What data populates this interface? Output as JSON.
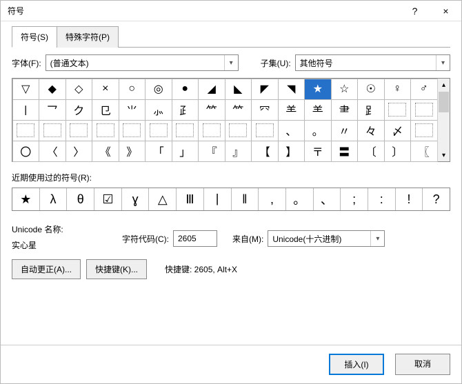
{
  "window": {
    "title": "符号",
    "help": "?",
    "close": "×"
  },
  "tabs": {
    "symbol": "符号(S)",
    "special": "特殊字符(P)"
  },
  "font": {
    "label": "字体(F):",
    "value": "(普通文本)"
  },
  "subset": {
    "label": "子集(U):",
    "value": "其他符号"
  },
  "grid": [
    [
      "▽",
      "◆",
      "◇",
      "×",
      "○",
      "◎",
      "●",
      "◢",
      "◣",
      "◤",
      "◥",
      "★",
      "☆",
      "☉",
      "♀",
      "♂"
    ],
    [
      "〡",
      "乛",
      "ク",
      "⺋",
      "⺌",
      "⺗",
      "⺪",
      "⺮",
      "⺮",
      "⺳",
      "⺷",
      "⺷",
      "⺻",
      "⻊",
      "⬚",
      "⬚"
    ],
    [
      "⬚",
      "⬚",
      "⬚",
      "⬚",
      "⬚",
      "⬚",
      "⬚",
      "⬚",
      "⬚",
      "⬚",
      "、",
      "。",
      "〃",
      "々",
      "〆",
      "⬚"
    ],
    [
      "〇",
      "〈",
      "〉",
      "《",
      "》",
      "「",
      "」",
      "『",
      "』",
      "【",
      "】",
      "〒",
      "〓",
      "〔",
      "〕",
      "〖"
    ]
  ],
  "selected_cell": {
    "row": 0,
    "col": 11
  },
  "recent": {
    "label": "近期使用过的符号(R):",
    "items": [
      "★",
      "λ",
      "θ",
      "☑",
      "ɣ",
      "△",
      "Ⅲ",
      "丨",
      "‖",
      ",",
      "。",
      "、",
      ";",
      ":",
      "!",
      "?"
    ]
  },
  "unicode": {
    "name_label": "Unicode 名称:",
    "name_value": "实心星",
    "code_label": "字符代码(C):",
    "code_value": "2605",
    "from_label": "来自(M):",
    "from_value": "Unicode(十六进制)"
  },
  "buttons": {
    "autocorrect": "自动更正(A)...",
    "shortcut": "快捷键(K)...",
    "shortcut_label": "快捷键: 2605, Alt+X",
    "insert": "插入(I)",
    "cancel": "取消"
  }
}
